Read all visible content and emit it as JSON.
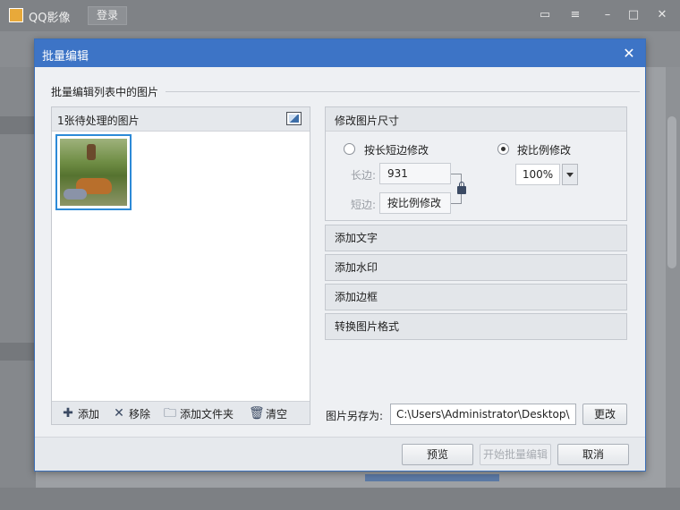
{
  "app": {
    "title": "QQ影像",
    "login_label": "登录"
  },
  "dialog": {
    "title": "批量编辑",
    "close_glyph": "✕",
    "section_label": "批量编辑列表中的图片",
    "image_panel": {
      "title": "1张待处理的图片",
      "actions": [
        {
          "label": "添加",
          "icon": "plus-icon"
        },
        {
          "label": "移除",
          "icon": "close-icon"
        },
        {
          "label": "添加文件夹",
          "icon": "folder-add-icon"
        },
        {
          "label": "清空",
          "icon": "trash-icon"
        }
      ]
    },
    "resize": {
      "title": "修改图片尺寸",
      "option_long_short": "按长短边修改",
      "option_ratio": "按比例修改",
      "selected_option": "按比例修改",
      "long_edge_label": "长边:",
      "long_edge_value": "931",
      "short_edge_label": "短边:",
      "short_edge_value": "按比例修改",
      "ratio_value": "100%"
    },
    "accordion": [
      {
        "label": "添加文字"
      },
      {
        "label": "添加水印"
      },
      {
        "label": "添加边框"
      },
      {
        "label": "转换图片格式"
      }
    ],
    "save_as": {
      "label": "图片另存为:",
      "path": "C:\\Users\\Administrator\\Desktop\\",
      "change_label": "更改"
    },
    "footer": {
      "preview_label": "预览",
      "start_label": "开始批量编辑",
      "cancel_label": "取消"
    }
  },
  "colors": {
    "dialog_header": "#3d74c6",
    "selection_border": "#2d8ad7"
  }
}
